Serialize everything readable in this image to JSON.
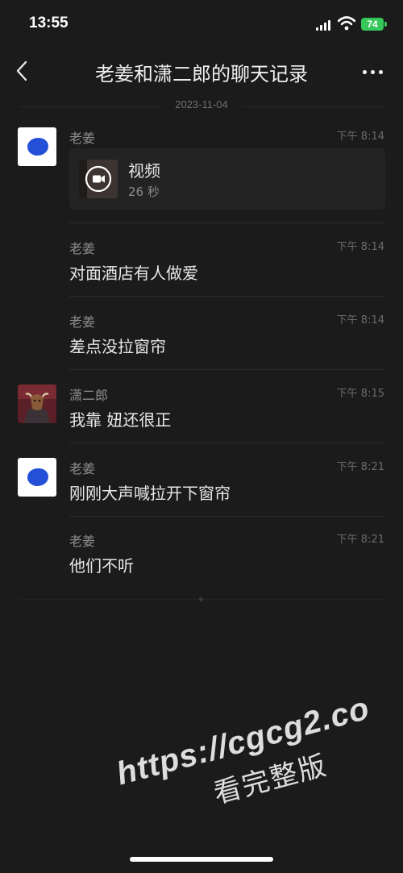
{
  "status_bar": {
    "time": "13:55",
    "battery": "74",
    "battery_color": "#35c759"
  },
  "nav": {
    "back_icon": "chevron-left-icon",
    "title": "老姜和潇二郎的聊天记录",
    "more_icon": "ellipsis-icon"
  },
  "date_separator": "2023-11-04",
  "messages": [
    {
      "sender": "老姜",
      "time": "下午 8:14",
      "type": "video",
      "video_title": "视频",
      "video_duration": "26 秒",
      "avatar": "blue-blob-avatar"
    },
    {
      "sender": "老姜",
      "time": "下午 8:14",
      "text": "对面酒店有人做爱"
    },
    {
      "sender": "老姜",
      "time": "下午 8:14",
      "text": "差点没拉窗帘"
    },
    {
      "sender": "潇二郎",
      "time": "下午 8:15",
      "text": "我靠 妞还很正",
      "avatar": "bull-photo-avatar"
    },
    {
      "sender": "老姜",
      "time": "下午 8:21",
      "text": "刚刚大声喊拉开下窗帘",
      "avatar": "blue-blob-avatar"
    },
    {
      "sender": "老姜",
      "time": "下午 8:21",
      "text": "他们不听"
    }
  ],
  "watermark": {
    "url": "https://cgcg2.co",
    "subtitle": "看完整版"
  },
  "colors": {
    "background": "#1b1b1b",
    "avatar_blue": "#2450d8"
  }
}
